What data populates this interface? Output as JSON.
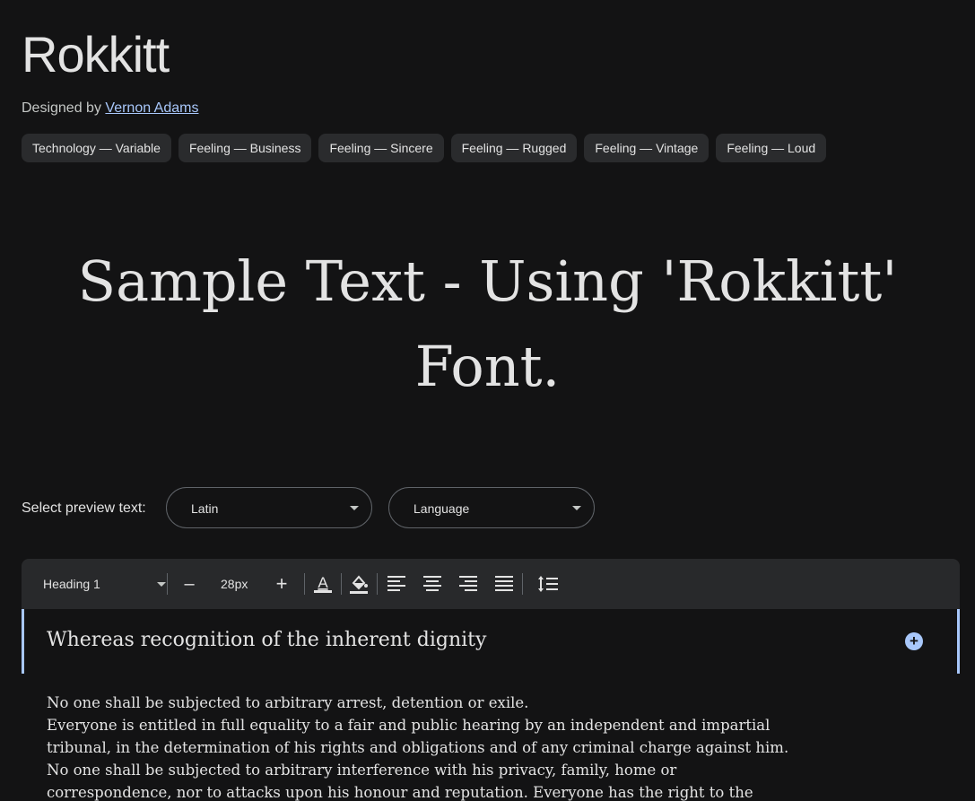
{
  "font": {
    "name": "Rokkitt",
    "designed_by_label": "Designed by",
    "designer": "Vernon Adams"
  },
  "tags": [
    "Technology — Variable",
    "Feeling — Business",
    "Feeling — Sincere",
    "Feeling — Rugged",
    "Feeling — Vintage",
    "Feeling — Loud"
  ],
  "sample": {
    "line1": "Sample Text - Using 'Rokkitt'",
    "line2": "Font."
  },
  "preview": {
    "label": "Select preview text:",
    "script_select": "Latin",
    "language_select": "Language"
  },
  "toolbar": {
    "style_select": "Heading 1",
    "decrease": "–",
    "size": "28px",
    "increase": "+"
  },
  "editor": {
    "heading": "Whereas recognition of the inherent dignity",
    "add_label": "+",
    "body_lines": [
      "No one shall be subjected to arbitrary arrest, detention or exile.",
      "Everyone is entitled in full equality to a fair and public hearing by an independent and impartial",
      "tribunal, in the determination of his rights and obligations and of any criminal charge against him.",
      "No one shall be subjected to arbitrary interference with his privacy, family, home or",
      "correspondence, nor to attacks upon his honour and reputation. Everyone has the right to the"
    ]
  },
  "colors": {
    "background": "#131314",
    "accent": "#a8c7fa",
    "chip": "#2a2b2d",
    "toolbar": "#28292b"
  }
}
